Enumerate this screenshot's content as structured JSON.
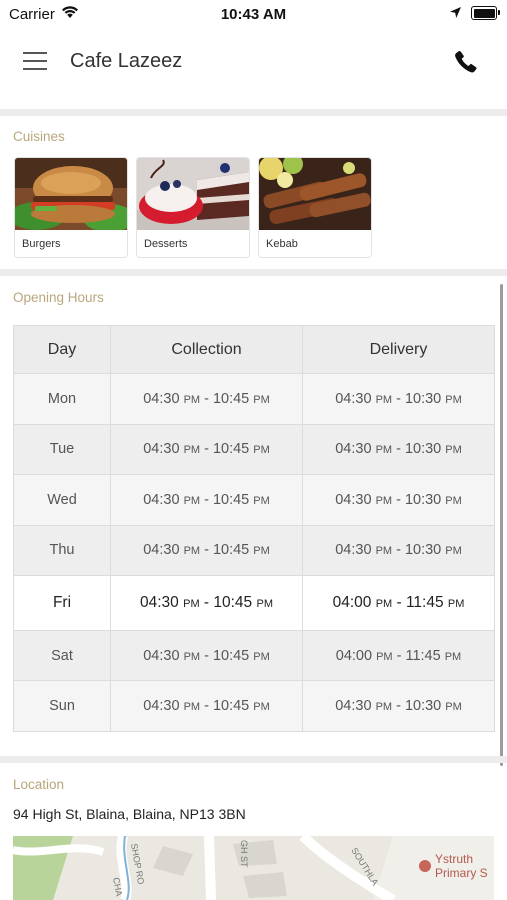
{
  "status_bar": {
    "carrier": "Carrier",
    "time": "10:43 AM"
  },
  "header": {
    "title": "Cafe Lazeez"
  },
  "cuisines": {
    "label": "Cuisines",
    "items": [
      {
        "name": "Burgers"
      },
      {
        "name": "Desserts"
      },
      {
        "name": "Kebab"
      }
    ]
  },
  "opening_hours": {
    "label": "Opening Hours",
    "columns": [
      "Day",
      "Collection",
      "Delivery"
    ],
    "rows": [
      {
        "day": "Mon",
        "collection": [
          "04:30",
          "PM",
          " - 10:45 ",
          "PM"
        ],
        "delivery": [
          "04:30",
          "PM",
          " - 10:30 ",
          "PM"
        ]
      },
      {
        "day": "Tue",
        "collection": [
          "04:30",
          "PM",
          " - 10:45 ",
          "PM"
        ],
        "delivery": [
          "04:30",
          "PM",
          " - 10:30 ",
          "PM"
        ]
      },
      {
        "day": "Wed",
        "collection": [
          "04:30",
          "PM",
          " - 10:45 ",
          "PM"
        ],
        "delivery": [
          "04:30",
          "PM",
          " - 10:30 ",
          "PM"
        ]
      },
      {
        "day": "Thu",
        "collection": [
          "04:30",
          "PM",
          " - 10:45 ",
          "PM"
        ],
        "delivery": [
          "04:30",
          "PM",
          " - 10:30 ",
          "PM"
        ]
      },
      {
        "day": "Fri",
        "collection": [
          "04:30",
          "PM",
          " - 10:45 ",
          "PM"
        ],
        "delivery": [
          "04:00",
          "PM",
          " - 11:45 ",
          "PM"
        ]
      },
      {
        "day": "Sat",
        "collection": [
          "04:30",
          "PM",
          " - 10:45 ",
          "PM"
        ],
        "delivery": [
          "04:00",
          "PM",
          " - 11:45 ",
          "PM"
        ]
      },
      {
        "day": "Sun",
        "collection": [
          "04:30",
          "PM",
          " - 10:45 ",
          "PM"
        ],
        "delivery": [
          "04:30",
          "PM",
          " - 10:30 ",
          "PM"
        ]
      }
    ]
  },
  "location": {
    "label": "Location",
    "address": "94 High St, Blaina, Blaina, NP13 3BN",
    "map_labels": {
      "poi": "Ystruth",
      "poi2": "Primary S",
      "road1": "SHOP RO",
      "road2": "GH ST",
      "road3": "SOUTHLA",
      "road4": "CHA"
    }
  }
}
